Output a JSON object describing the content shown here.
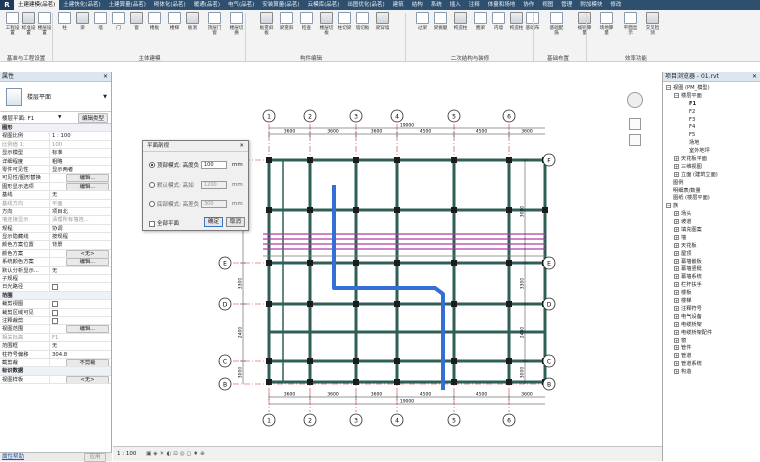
{
  "app": {
    "logo": "R"
  },
  "tabs": [
    "土建建模(品茗)",
    "土建快化(品茗)",
    "土建算量(品茗)",
    "砌体化(品茗)",
    "暖通(品茗)",
    "电气(品茗)",
    "安装算量(品茗)",
    "云模库(品茗)",
    "出图优化(品茗)",
    "建筑",
    "结构",
    "系统",
    "插入",
    "注释",
    "体量和场地",
    "协作",
    "视图",
    "管理",
    "附加模块",
    "修改"
  ],
  "ribbon": {
    "buttons": [
      "工程设置",
      "标准设置",
      "楼层设置",
      "柱",
      "梁",
      "墙",
      "门",
      "窗",
      "楼板",
      "楼梯",
      "板洞",
      "顶层门窗",
      "楼层切换",
      "板变斜板",
      "梁变斜",
      "检查",
      "楼层切板",
      "柱切梁",
      "墙切板",
      "梁穿墙",
      "过梁",
      "梁挑腿",
      "构造柱",
      "圈梁",
      "内墙",
      "构造柱",
      "基础布",
      "基础配筋",
      "规则算量",
      "场地算量",
      "平面显示",
      "交叉检测"
    ],
    "groups": [
      "基准与工程设置",
      "主体建模",
      "构件编辑",
      "二次结构与装修",
      "基础布置",
      "效率功能"
    ]
  },
  "left_panel": {
    "title": "属性",
    "type_name": "楼层平面",
    "selector": "楼层平面: F1",
    "edit_type": "编辑类型",
    "rows": [
      {
        "k": "图形",
        "v": "",
        "sec": true
      },
      {
        "k": "视图比例",
        "v": "1 : 100"
      },
      {
        "k": "比例值 1:",
        "v": "100",
        "dim": true
      },
      {
        "k": "显示模型",
        "v": "标准"
      },
      {
        "k": "详细程度",
        "v": "粗略"
      },
      {
        "k": "零件可见性",
        "v": "显示两者"
      },
      {
        "k": "可见性/图形替换",
        "v": "编辑...",
        "btn": true
      },
      {
        "k": "图形显示选项",
        "v": "编辑...",
        "btn": true
      },
      {
        "k": "基线",
        "v": "无"
      },
      {
        "k": "基线方向",
        "v": "平面",
        "dim": true
      },
      {
        "k": "方向",
        "v": "项目北"
      },
      {
        "k": "墙连接显示",
        "v": "清理所有墙连...",
        "dim": true
      },
      {
        "k": "规程",
        "v": "协调"
      },
      {
        "k": "显示隐藏线",
        "v": "按规程"
      },
      {
        "k": "颜色方案位置",
        "v": "背景"
      },
      {
        "k": "颜色方案",
        "v": "<无>",
        "btn": true
      },
      {
        "k": "系统颜色方案",
        "v": "编辑...",
        "btn": true
      },
      {
        "k": "默认分析显示...",
        "v": "无"
      },
      {
        "k": "子规程",
        "v": ""
      },
      {
        "k": "日光路径",
        "v": "",
        "chk": true
      },
      {
        "k": "范围",
        "v": "",
        "sec": true
      },
      {
        "k": "裁剪视图",
        "v": "",
        "chk": true
      },
      {
        "k": "裁剪区域可见",
        "v": "",
        "chk": true
      },
      {
        "k": "注释裁剪",
        "v": "",
        "chk": true
      },
      {
        "k": "视图范围",
        "v": "编辑...",
        "btn": true
      },
      {
        "k": "相关标高",
        "v": "F1",
        "dim": true
      },
      {
        "k": "范围框",
        "v": "无"
      },
      {
        "k": "柱符号偏移",
        "v": "304.8"
      },
      {
        "k": "截剪裁",
        "v": "不剪裁",
        "btn": true
      },
      {
        "k": "标识数据",
        "v": "",
        "sec": true
      },
      {
        "k": "视图样板",
        "v": "<无>",
        "btn": true
      }
    ],
    "help_link": "属性帮助",
    "apply": "应用"
  },
  "dialog": {
    "title": "平面剖视",
    "opt1": "顶部模式: 高度负",
    "opt1_val": "100",
    "opt2": "默认模式: 高如",
    "opt2_val": "1200",
    "opt3": "底部模式: 高差负",
    "opt3_val": "300",
    "unit": "mm",
    "all_floors": "全部平面",
    "ok": "确定",
    "cancel": "取消"
  },
  "drawing": {
    "axes_top": [
      "1",
      "2",
      "3",
      "4",
      "5",
      "6"
    ],
    "axes_bottom": [
      "1",
      "2",
      "3",
      "4",
      "5",
      "6"
    ],
    "axes_side": [
      "F",
      "E",
      "D",
      "C",
      "B"
    ],
    "top_spans": [
      "3600",
      "3600",
      "3600",
      "4500",
      "4500",
      "3600"
    ],
    "bottom_spans": [
      "3600",
      "3600",
      "3600",
      "4500",
      "4500",
      "3600"
    ],
    "total": "19000",
    "side_spans": [
      "3000",
      "3300",
      "2400",
      "3000"
    ]
  },
  "status": {
    "scale": "1 : 100"
  },
  "right_panel": {
    "title": "项目浏览器 - 01.rvt",
    "tree": [
      {
        "t": "视图 (PM_模型)",
        "lvl": 0,
        "ex": "−"
      },
      {
        "t": "楼层平面",
        "lvl": 1,
        "ex": "−"
      },
      {
        "t": "F1",
        "lvl": 2,
        "bold": true
      },
      {
        "t": "F2",
        "lvl": 2
      },
      {
        "t": "F3",
        "lvl": 2
      },
      {
        "t": "F4",
        "lvl": 2
      },
      {
        "t": "F5",
        "lvl": 2
      },
      {
        "t": "场地",
        "lvl": 2
      },
      {
        "t": "室外地坪",
        "lvl": 2
      },
      {
        "t": "天花板平面",
        "lvl": 1,
        "ex": "+"
      },
      {
        "t": "三维视图",
        "lvl": 1,
        "ex": "+"
      },
      {
        "t": "立面 (建筑立面)",
        "lvl": 1,
        "ex": "+"
      },
      {
        "t": "图例",
        "lvl": 0
      },
      {
        "t": "明细表/数量",
        "lvl": 0
      },
      {
        "t": "图纸 (楼层平面)",
        "lvl": 0
      },
      {
        "t": "族",
        "lvl": 0,
        "ex": "−"
      },
      {
        "t": "场头",
        "lvl": 1,
        "ex": "+"
      },
      {
        "t": "坡道",
        "lvl": 1,
        "ex": "+"
      },
      {
        "t": "填充图案",
        "lvl": 1,
        "ex": "+"
      },
      {
        "t": "墙",
        "lvl": 1,
        "ex": "+"
      },
      {
        "t": "天花板",
        "lvl": 1,
        "ex": "+"
      },
      {
        "t": "屋顶",
        "lvl": 1,
        "ex": "+"
      },
      {
        "t": "幕墙嵌板",
        "lvl": 1,
        "ex": "+"
      },
      {
        "t": "幕墙竖梃",
        "lvl": 1,
        "ex": "+"
      },
      {
        "t": "幕墙系统",
        "lvl": 1,
        "ex": "+"
      },
      {
        "t": "栏杆扶手",
        "lvl": 1,
        "ex": "+"
      },
      {
        "t": "楼板",
        "lvl": 1,
        "ex": "+"
      },
      {
        "t": "楼梯",
        "lvl": 1,
        "ex": "+"
      },
      {
        "t": "注释符号",
        "lvl": 1,
        "ex": "+"
      },
      {
        "t": "电气设备",
        "lvl": 1,
        "ex": "+"
      },
      {
        "t": "电缆桥架",
        "lvl": 1,
        "ex": "+"
      },
      {
        "t": "电缆桥架配件",
        "lvl": 1,
        "ex": "+"
      },
      {
        "t": "窗",
        "lvl": 1,
        "ex": "+"
      },
      {
        "t": "管件",
        "lvl": 1,
        "ex": "+"
      },
      {
        "t": "管道",
        "lvl": 1,
        "ex": "+"
      },
      {
        "t": "管道系统",
        "lvl": 1,
        "ex": "+"
      },
      {
        "t": "构造",
        "lvl": 1,
        "ex": "+"
      }
    ]
  }
}
